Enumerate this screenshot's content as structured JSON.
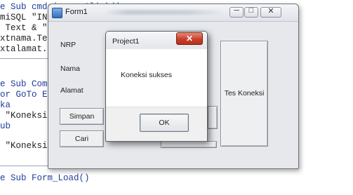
{
  "editor": {
    "lines": [
      "e Sub cmdsimpan_Click()",
      "miSQL \"INS",
      " Text & \"",
      "xtnama.Te",
      "xtalamat.",
      "e Sub Comm",
      "or GoTo Er",
      "ka",
      " \"Koneksi",
      "ub",
      " \"Koneksi",
      "e Sub Form_Load()"
    ]
  },
  "form1": {
    "title": "Form1",
    "labels": {
      "nrp": "NRP",
      "nama": "Nama",
      "alamat": "Alamat"
    },
    "buttons": {
      "simpan": "Simpan",
      "cari": "Cari",
      "tes_koneksi": "Tes Koneksi"
    }
  },
  "msgbox": {
    "title": "Project1",
    "message": "Koneksi sukses",
    "ok_label": "OK",
    "close_glyph": "✕"
  },
  "titlebar_glyphs": {
    "minimize": "─",
    "maximize": "□",
    "close": "✕"
  }
}
